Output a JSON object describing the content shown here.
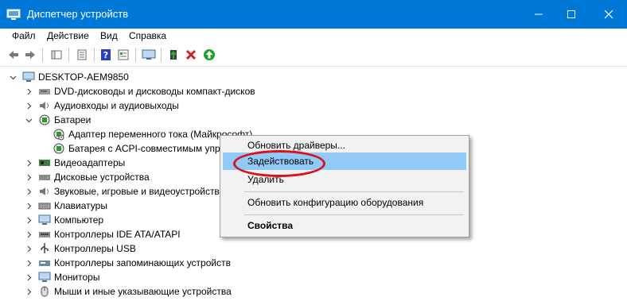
{
  "window": {
    "title": "Диспетчер устройств",
    "controls": [
      "minimize-icon",
      "maximize-icon",
      "close-icon"
    ]
  },
  "menu": [
    "Файл",
    "Действие",
    "Вид",
    "Справка"
  ],
  "toolbar": [
    "back-arrow-icon",
    "forward-arrow-icon",
    "properties-icon",
    "details-icon",
    "help-icon",
    "properties-sheet-icon",
    "monitor-icon",
    "update-driver-icon",
    "uninstall-x-icon",
    "enable-device-icon"
  ],
  "tree": {
    "root": "DESKTOP-AEM9850",
    "items": [
      {
        "label": "DVD-дисководы и дисководы компакт-дисков",
        "icon": "dvd-drive-icon"
      },
      {
        "label": "Аудиовходы и аудиовыходы",
        "icon": "audio-icon"
      },
      {
        "label": "Батареи",
        "icon": "battery-icon",
        "expanded": true
      },
      {
        "label": "Адаптер переменного тока (Майкрософт)",
        "icon": "battery-device-icon",
        "child": true,
        "disabled": true
      },
      {
        "label": "Батарея с ACPI-совместимым упр",
        "icon": "battery-device-icon",
        "child": true
      },
      {
        "label": "Видеоадаптеры",
        "icon": "display-adapter-icon"
      },
      {
        "label": "Дисковые устройства",
        "icon": "disk-drive-icon"
      },
      {
        "label": "Звуковые, игровые и видеоустройства",
        "icon": "sound-icon"
      },
      {
        "label": "Клавиатуры",
        "icon": "keyboard-icon"
      },
      {
        "label": "Компьютер",
        "icon": "computer-icon"
      },
      {
        "label": "Контроллеры IDE ATA/ATAPI",
        "icon": "ide-controller-icon"
      },
      {
        "label": "Контроллеры USB",
        "icon": "usb-icon"
      },
      {
        "label": "Контроллеры запоминающих устройств",
        "icon": "storage-controller-icon"
      },
      {
        "label": "Мониторы",
        "icon": "monitor-icon"
      },
      {
        "label": "Мыши и иные указывающие устройства",
        "icon": "mouse-icon"
      }
    ]
  },
  "context_menu": {
    "update": "Обновить драйверы...",
    "enable": "Задействовать",
    "remove": "Удалить",
    "scan": "Обновить конфигурацию оборудования",
    "properties": "Свойства"
  },
  "colors": {
    "titlebar": "#0078d7",
    "highlight": "#91c9f7",
    "annotation": "#d9121c"
  }
}
